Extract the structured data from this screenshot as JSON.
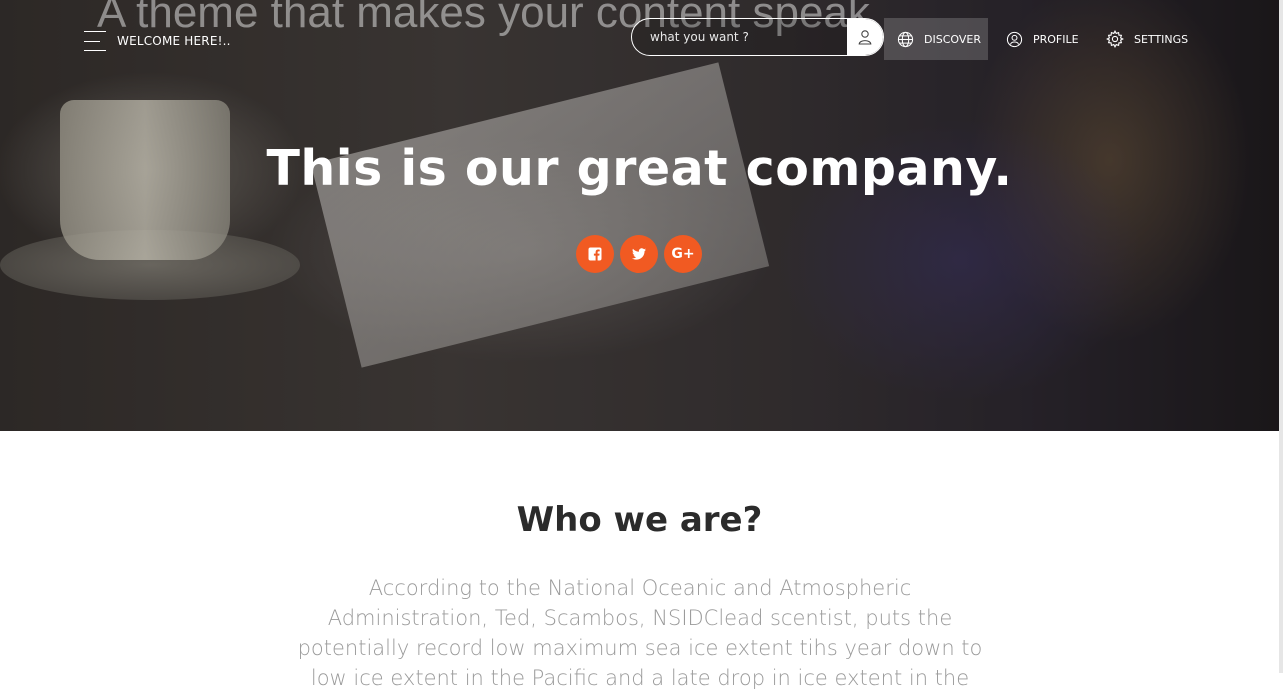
{
  "nav": {
    "welcome": "WELCOME HERE!..",
    "search_placeholder": "what you want ?",
    "items": [
      {
        "label": "DISCOVER",
        "icon": "globe-icon"
      },
      {
        "label": "PROFILE",
        "icon": "user-circle-icon"
      },
      {
        "label": "SETTINGS",
        "icon": "gear-icon"
      }
    ]
  },
  "hero": {
    "background_text": "A theme that makes your content speak",
    "title": "This is our great company.",
    "social": [
      {
        "name": "facebook-icon",
        "glyph": "f"
      },
      {
        "name": "twitter-icon",
        "glyph": "t"
      },
      {
        "name": "google-plus-icon",
        "glyph": "G+"
      }
    ],
    "accent_color": "#f15a22"
  },
  "about": {
    "title": "Who we are?",
    "text": "According to the National Oceanic and Atmospheric Administration, Ted, Scambos, NSIDClead scentist, puts the potentially record low maximum sea ice extent tihs year down to low ice extent in the Pacific and a late drop in ice extent in the"
  }
}
